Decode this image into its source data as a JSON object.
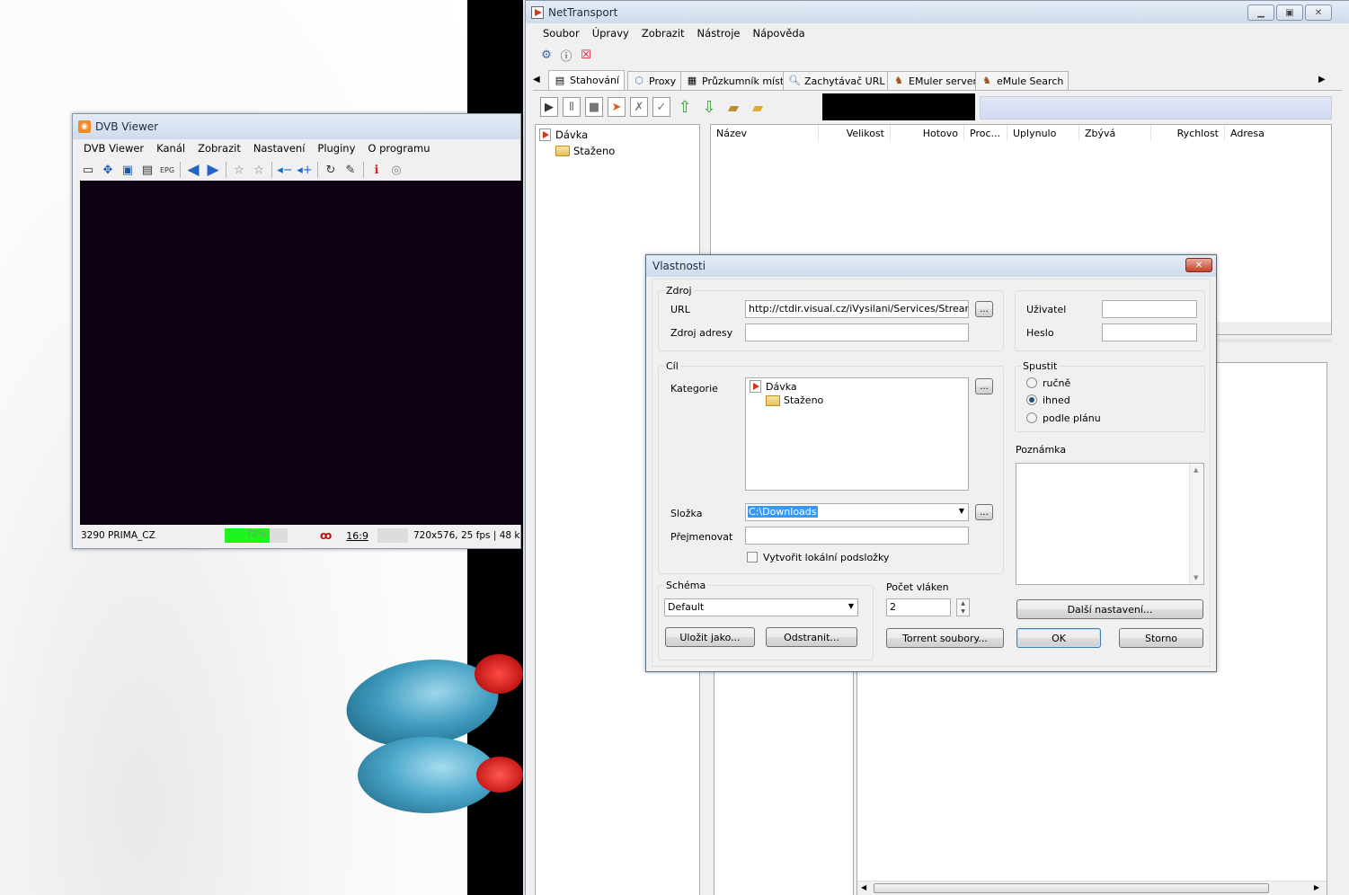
{
  "dvb": {
    "title": "DVB Viewer",
    "menu": [
      "DVB Viewer",
      "Kanál",
      "Zobrazit",
      "Nastavení",
      "Pluginy",
      "O programu"
    ],
    "status": {
      "channel": "3290 PRIMA_CZ",
      "signal_text": "72%",
      "signal_level": 0.72,
      "aspect": "16:9",
      "video": "720x576, 25 fps | 48 k"
    }
  },
  "nt": {
    "title": "NetTransport",
    "menu": [
      "Soubor",
      "Úpravy",
      "Zobrazit",
      "Nástroje",
      "Nápověda"
    ],
    "tabs": [
      "Stahování",
      "Proxy",
      "Průzkumník míst",
      "Zachytávač URL",
      "EMuler server",
      "eMule Search"
    ],
    "tree": {
      "batch": "Dávka",
      "downloaded": "Staženo"
    },
    "columns": [
      "Název",
      "Velikost",
      "Hotovo",
      "Proc...",
      "Uplynulo",
      "Zbývá",
      "Rychlost",
      "Adresa"
    ]
  },
  "dialog": {
    "title": "Vlastnosti",
    "source": {
      "group": "Zdroj",
      "url_label": "URL",
      "url_value": "http://ctdir.visual.cz/iVysilani/Services/Streaming/C",
      "referer_label": "Zdroj adresy",
      "referer_value": "",
      "browse": "..."
    },
    "auth": {
      "user_label": "Uživatel",
      "user_value": "",
      "pass_label": "Heslo",
      "pass_value": ""
    },
    "target": {
      "group": "Cíl",
      "category_label": "Kategorie",
      "tree_batch": "Dávka",
      "tree_downloaded": "Staženo",
      "folder_label": "Složka",
      "folder_value": "C:\\Downloads",
      "rename_label": "Přejmenovat",
      "rename_value": "",
      "subfolders_label": "Vytvořit lokální podsložky",
      "browse": "..."
    },
    "start": {
      "group": "Spustit",
      "options": [
        "ručně",
        "ihned",
        "podle plánu"
      ],
      "selected": "ihned"
    },
    "note_label": "Poznámka",
    "schema": {
      "group": "Schéma",
      "value": "Default",
      "save_as": "Uložit jako...",
      "remove": "Odstranit..."
    },
    "threads": {
      "label": "Počet vláken",
      "value": "2"
    },
    "buttons": {
      "more": "Další nastavení...",
      "torrent": "Torrent soubory...",
      "ok": "OK",
      "cancel": "Storno"
    }
  }
}
